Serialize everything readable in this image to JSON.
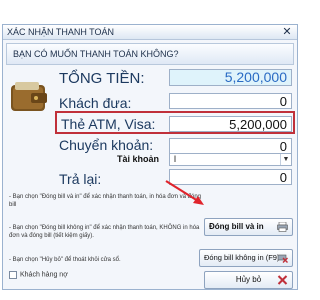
{
  "window": {
    "title": "XÁC NHẬN THANH TOÁN",
    "close_glyph": "✕"
  },
  "question": "BẠN CÓ MUỐN THANH TOÁN KHÔNG?",
  "fields": {
    "total_label": "TỔNG TIỀN:",
    "total_value": "5,200,000",
    "paid_label": "Khách đưa:",
    "paid_value": "0",
    "card_label": "Thẻ ATM, Visa:",
    "card_value": "5,200,000",
    "transfer_label": "Chuyển khoản:",
    "transfer_value": "0",
    "account_label": "Tài khoản",
    "account_value": "l",
    "change_label": "Trả lại:",
    "change_value": "0"
  },
  "notes": {
    "note_1": "- Bạn chọn \"Đóng bill và in\" để xác nhận thanh toán, in hóa đơn và đóng bill",
    "note_2": "- Bạn chọn \"Đóng bill không in\" để xác nhận thanh toán, KHÔNG in hóa đơn và đóng bill (tiết kiệm giấy).",
    "note_3": "- Bạn chọn \"Hủy bỏ\" để thoát khỏi cửa sổ."
  },
  "checkbox": {
    "label": "Khách hàng nợ",
    "checked": false
  },
  "buttons": {
    "print_label": "Đóng bill và in",
    "noprint_label": "Đóng bill không in (F9)",
    "cancel_label": "Hủy bỏ"
  },
  "icons": {
    "wallet": "wallet-icon",
    "printer": "printer-icon",
    "no_print": "no-print-icon",
    "cancel": "cancel-icon"
  },
  "colors": {
    "accent_red": "#c0303a",
    "label_blue": "#1d3a60",
    "total_blue": "#2a6bc4"
  }
}
